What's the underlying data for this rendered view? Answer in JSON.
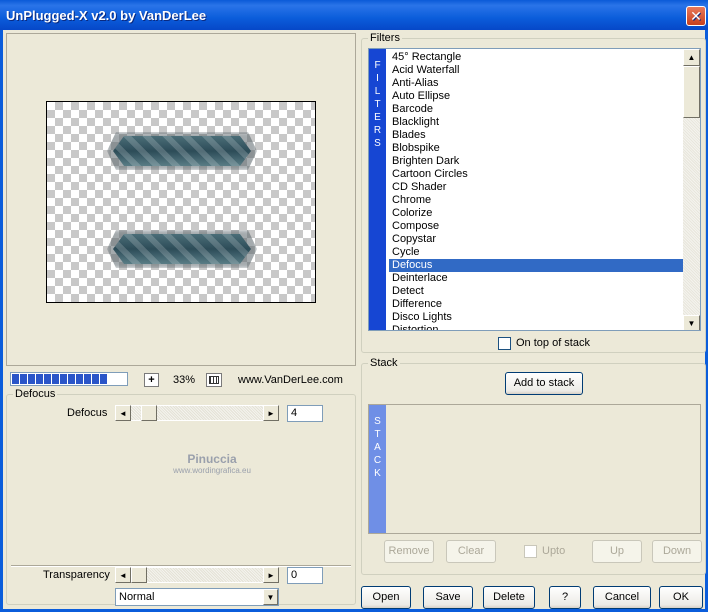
{
  "window": {
    "title": "UnPlugged-X v2.0 by VanDerLee",
    "close_glyph": "✕"
  },
  "preview": {
    "zoom_in_glyph": "+",
    "zoom": "33%",
    "url": "www.VanDerLee.com",
    "progress_segments": 12
  },
  "filters": {
    "group_label": "Filters",
    "tag": [
      "F",
      "I",
      "L",
      "T",
      "E",
      "R",
      "S"
    ],
    "items": [
      "45° Rectangle",
      "Acid Waterfall",
      "Anti-Alias",
      "Auto Ellipse",
      "Barcode",
      "Blacklight",
      "Blades",
      "Blobspike",
      "Brighten Dark",
      "Cartoon Circles",
      "CD Shader",
      "Chrome",
      "Colorize",
      "Compose",
      "Copystar",
      "Cycle",
      "Defocus",
      "Deinterlace",
      "Detect",
      "Difference",
      "Disco Lights",
      "Distortion"
    ],
    "selected": "Defocus",
    "on_top_label": "On top of stack",
    "scroll_up_glyph": "▲",
    "scroll_down_glyph": "▼"
  },
  "params": {
    "group_label": "Defocus",
    "defocus_label": "Defocus",
    "defocus_value": "4",
    "defocus_level": 0,
    "watermark_name": "Pinuccia",
    "watermark_url": "www.wordingrafica.eu",
    "transparency_label": "Transparency",
    "transparency_value": "0",
    "blend_mode": "Normal",
    "left_glyph": "◄",
    "right_glyph": "►",
    "dropdown_glyph": "▼"
  },
  "stack": {
    "group_label": "Stack",
    "add_label": "Add to stack",
    "tag": [
      "S",
      "T",
      "A",
      "C",
      "K"
    ],
    "remove_label": "Remove",
    "clear_label": "Clear",
    "upto_label": "Upto",
    "up_label": "Up",
    "down_label": "Down"
  },
  "footer": {
    "open": "Open",
    "save": "Save",
    "delete": "Delete",
    "help": "?",
    "cancel": "Cancel",
    "ok": "OK"
  }
}
